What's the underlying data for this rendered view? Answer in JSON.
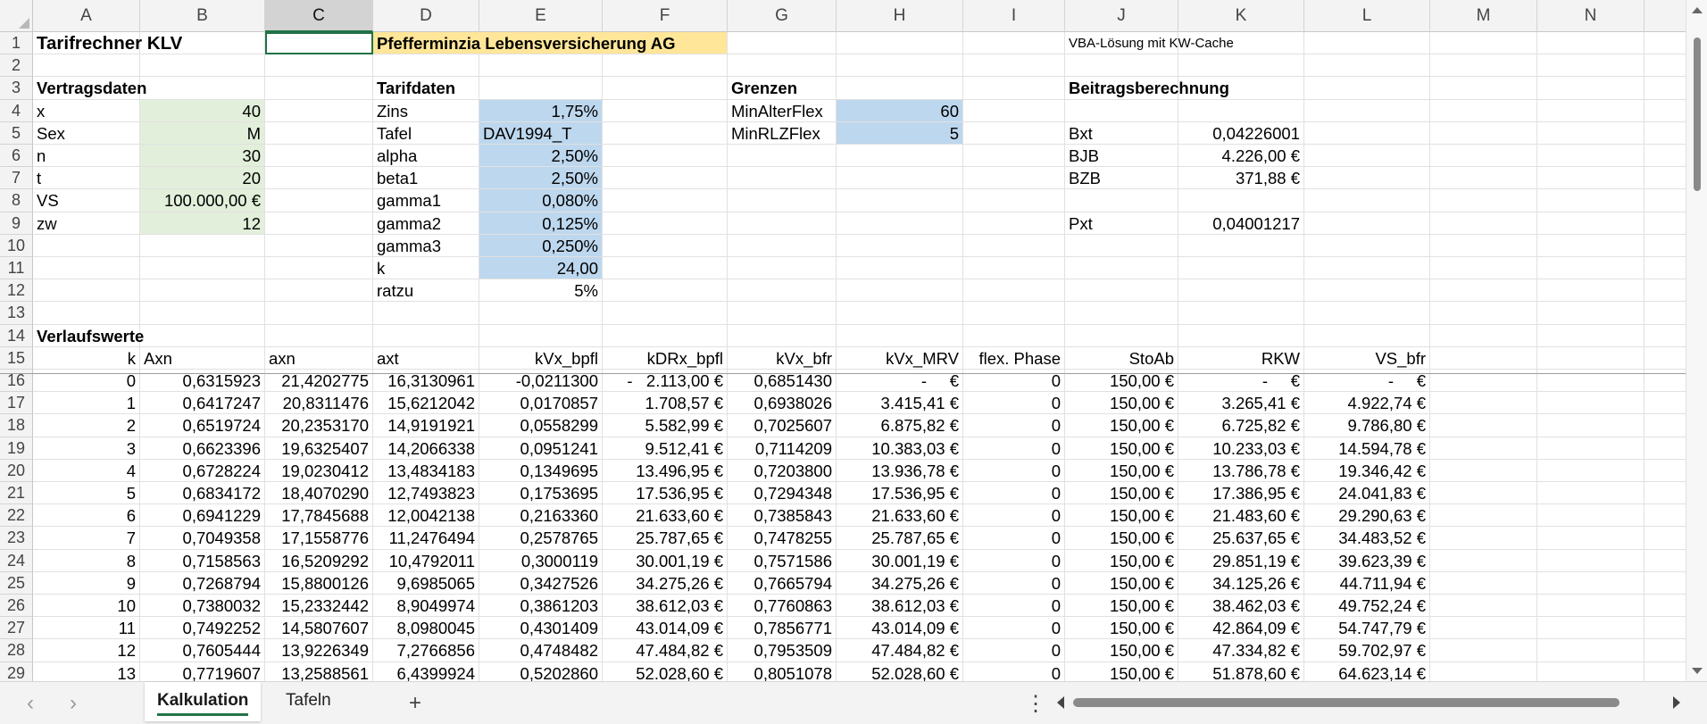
{
  "columns": [
    {
      "id": "A",
      "width": 120
    },
    {
      "id": "B",
      "width": 140
    },
    {
      "id": "C",
      "width": 121
    },
    {
      "id": "D",
      "width": 119
    },
    {
      "id": "E",
      "width": 138
    },
    {
      "id": "F",
      "width": 140
    },
    {
      "id": "G",
      "width": 122
    },
    {
      "id": "H",
      "width": 142
    },
    {
      "id": "I",
      "width": 114
    },
    {
      "id": "J",
      "width": 127
    },
    {
      "id": "K",
      "width": 141
    },
    {
      "id": "L",
      "width": 141
    },
    {
      "id": "M",
      "width": 120
    },
    {
      "id": "N",
      "width": 120
    },
    {
      "id": "O",
      "width": 200
    }
  ],
  "selected_column": "C",
  "rows": [
    {
      "n": 1,
      "cells": [
        {
          "c": "A",
          "v": "Tarifrechner KLV",
          "b": true,
          "big": true
        },
        {
          "c": "C",
          "v": "",
          "sel": true
        },
        {
          "c": "D",
          "v": "Pfefferminzia Lebensversicherung AG",
          "b": true,
          "fill": "yellow",
          "span": 3
        },
        {
          "c": "J",
          "v": "VBA-Lösung mit KW-Cache",
          "small": true,
          "span": 2
        }
      ]
    },
    {
      "n": 2,
      "cells": []
    },
    {
      "n": 3,
      "cells": [
        {
          "c": "A",
          "v": "Vertragsdaten",
          "b": true,
          "span": 2
        },
        {
          "c": "D",
          "v": "Tarifdaten",
          "b": true
        },
        {
          "c": "G",
          "v": "Grenzen",
          "b": true
        },
        {
          "c": "J",
          "v": "Beitragsberechnung",
          "b": true,
          "span": 2
        }
      ]
    },
    {
      "n": 4,
      "cells": [
        {
          "c": "A",
          "v": "x"
        },
        {
          "c": "B",
          "v": "40",
          "r": true,
          "fill": "green"
        },
        {
          "c": "D",
          "v": "Zins"
        },
        {
          "c": "E",
          "v": "1,75%",
          "r": true,
          "fill": "blue"
        },
        {
          "c": "G",
          "v": "MinAlterFlex"
        },
        {
          "c": "H",
          "v": "60",
          "r": true,
          "fill": "blue"
        }
      ]
    },
    {
      "n": 5,
      "cells": [
        {
          "c": "A",
          "v": "Sex"
        },
        {
          "c": "B",
          "v": "M",
          "r": true,
          "fill": "green"
        },
        {
          "c": "D",
          "v": "Tafel"
        },
        {
          "c": "E",
          "v": "DAV1994_T",
          "fill": "blue"
        },
        {
          "c": "G",
          "v": "MinRLZFlex"
        },
        {
          "c": "H",
          "v": "5",
          "r": true,
          "fill": "blue"
        },
        {
          "c": "J",
          "v": "Bxt"
        },
        {
          "c": "K",
          "v": "0,04226001",
          "r": true
        }
      ]
    },
    {
      "n": 6,
      "cells": [
        {
          "c": "A",
          "v": "n"
        },
        {
          "c": "B",
          "v": "30",
          "r": true,
          "fill": "green"
        },
        {
          "c": "D",
          "v": "alpha"
        },
        {
          "c": "E",
          "v": "2,50%",
          "r": true,
          "fill": "blue"
        },
        {
          "c": "J",
          "v": "BJB"
        },
        {
          "c": "K",
          "v": "4.226,00 €",
          "r": true
        }
      ]
    },
    {
      "n": 7,
      "cells": [
        {
          "c": "A",
          "v": "t"
        },
        {
          "c": "B",
          "v": "20",
          "r": true,
          "fill": "green"
        },
        {
          "c": "D",
          "v": "beta1"
        },
        {
          "c": "E",
          "v": "2,50%",
          "r": true,
          "fill": "blue"
        },
        {
          "c": "J",
          "v": "BZB"
        },
        {
          "c": "K",
          "v": "371,88 €",
          "r": true
        }
      ]
    },
    {
      "n": 8,
      "cells": [
        {
          "c": "A",
          "v": "VS"
        },
        {
          "c": "B",
          "v": "100.000,00 €",
          "r": true,
          "fill": "green"
        },
        {
          "c": "D",
          "v": "gamma1"
        },
        {
          "c": "E",
          "v": "0,080%",
          "r": true,
          "fill": "blue"
        }
      ]
    },
    {
      "n": 9,
      "cells": [
        {
          "c": "A",
          "v": "zw"
        },
        {
          "c": "B",
          "v": "12",
          "r": true,
          "fill": "green"
        },
        {
          "c": "D",
          "v": "gamma2"
        },
        {
          "c": "E",
          "v": "0,125%",
          "r": true,
          "fill": "blue"
        },
        {
          "c": "J",
          "v": "Pxt"
        },
        {
          "c": "K",
          "v": "0,04001217",
          "r": true
        }
      ]
    },
    {
      "n": 10,
      "cells": [
        {
          "c": "D",
          "v": "gamma3"
        },
        {
          "c": "E",
          "v": "0,250%",
          "r": true,
          "fill": "blue"
        }
      ]
    },
    {
      "n": 11,
      "cells": [
        {
          "c": "D",
          "v": "k"
        },
        {
          "c": "E",
          "v": "24,00",
          "r": true,
          "fill": "blue"
        }
      ]
    },
    {
      "n": 12,
      "cells": [
        {
          "c": "D",
          "v": "ratzu"
        },
        {
          "c": "E",
          "v": "5%",
          "r": true
        }
      ]
    },
    {
      "n": 13,
      "cells": []
    },
    {
      "n": 14,
      "cells": [
        {
          "c": "A",
          "v": "Verlaufswerte",
          "b": true,
          "span": 2
        }
      ]
    },
    {
      "n": 15,
      "cells": [
        {
          "c": "A",
          "v": "k",
          "r": true
        },
        {
          "c": "B",
          "v": "Axn"
        },
        {
          "c": "C",
          "v": "axn"
        },
        {
          "c": "D",
          "v": "axt"
        },
        {
          "c": "E",
          "v": "kVx_bpfl",
          "r": true
        },
        {
          "c": "F",
          "v": "kDRx_bpfl",
          "r": true
        },
        {
          "c": "G",
          "v": "kVx_bfr",
          "r": true
        },
        {
          "c": "H",
          "v": "kVx_MRV",
          "r": true
        },
        {
          "c": "I",
          "v": "flex. Phase",
          "r": true
        },
        {
          "c": "J",
          "v": "StoAb",
          "r": true
        },
        {
          "c": "K",
          "v": "RKW",
          "r": true
        },
        {
          "c": "L",
          "v": "VS_bfr",
          "r": true
        }
      ]
    }
  ],
  "table_rows": [
    {
      "n": 16,
      "vals": [
        "0",
        "0,6315923",
        "21,4202775",
        "16,3130961",
        "-0,0211300",
        "-   2.113,00 €",
        "0,6851430",
        "-     €",
        "0",
        "150,00 €",
        "-     €",
        "-     €"
      ]
    },
    {
      "n": 17,
      "vals": [
        "1",
        "0,6417247",
        "20,8311476",
        "15,6212042",
        "0,0170857",
        "1.708,57 €",
        "0,6938026",
        "3.415,41 €",
        "0",
        "150,00 €",
        "3.265,41 €",
        "4.922,74 €"
      ]
    },
    {
      "n": 18,
      "vals": [
        "2",
        "0,6519724",
        "20,2353170",
        "14,9191921",
        "0,0558299",
        "5.582,99 €",
        "0,7025607",
        "6.875,82 €",
        "0",
        "150,00 €",
        "6.725,82 €",
        "9.786,80 €"
      ]
    },
    {
      "n": 19,
      "vals": [
        "3",
        "0,6623396",
        "19,6325407",
        "14,2066338",
        "0,0951241",
        "9.512,41 €",
        "0,7114209",
        "10.383,03 €",
        "0",
        "150,00 €",
        "10.233,03 €",
        "14.594,78 €"
      ]
    },
    {
      "n": 20,
      "vals": [
        "4",
        "0,6728224",
        "19,0230412",
        "13,4834183",
        "0,1349695",
        "13.496,95 €",
        "0,7203800",
        "13.936,78 €",
        "0",
        "150,00 €",
        "13.786,78 €",
        "19.346,42 €"
      ]
    },
    {
      "n": 21,
      "vals": [
        "5",
        "0,6834172",
        "18,4070290",
        "12,7493823",
        "0,1753695",
        "17.536,95 €",
        "0,7294348",
        "17.536,95 €",
        "0",
        "150,00 €",
        "17.386,95 €",
        "24.041,83 €"
      ]
    },
    {
      "n": 22,
      "vals": [
        "6",
        "0,6941229",
        "17,7845688",
        "12,0042138",
        "0,2163360",
        "21.633,60 €",
        "0,7385843",
        "21.633,60 €",
        "0",
        "150,00 €",
        "21.483,60 €",
        "29.290,63 €"
      ]
    },
    {
      "n": 23,
      "vals": [
        "7",
        "0,7049358",
        "17,1558776",
        "11,2476494",
        "0,2578765",
        "25.787,65 €",
        "0,7478255",
        "25.787,65 €",
        "0",
        "150,00 €",
        "25.637,65 €",
        "34.483,52 €"
      ]
    },
    {
      "n": 24,
      "vals": [
        "8",
        "0,7158563",
        "16,5209292",
        "10,4792011",
        "0,3000119",
        "30.001,19 €",
        "0,7571586",
        "30.001,19 €",
        "0",
        "150,00 €",
        "29.851,19 €",
        "39.623,39 €"
      ]
    },
    {
      "n": 25,
      "vals": [
        "9",
        "0,7268794",
        "15,8800126",
        "9,6985065",
        "0,3427526",
        "34.275,26 €",
        "0,7665794",
        "34.275,26 €",
        "0",
        "150,00 €",
        "34.125,26 €",
        "44.711,94 €"
      ]
    },
    {
      "n": 26,
      "vals": [
        "10",
        "0,7380032",
        "15,2332442",
        "8,9049974",
        "0,3861203",
        "38.612,03 €",
        "0,7760863",
        "38.612,03 €",
        "0",
        "150,00 €",
        "38.462,03 €",
        "49.752,24 €"
      ]
    },
    {
      "n": 27,
      "vals": [
        "11",
        "0,7492252",
        "14,5807607",
        "8,0980045",
        "0,4301409",
        "43.014,09 €",
        "0,7856771",
        "43.014,09 €",
        "0",
        "150,00 €",
        "42.864,09 €",
        "54.747,79 €"
      ]
    },
    {
      "n": 28,
      "vals": [
        "12",
        "0,7605444",
        "13,9226349",
        "7,2766856",
        "0,4748482",
        "47.484,82 €",
        "0,7953509",
        "47.484,82 €",
        "0",
        "150,00 €",
        "47.334,82 €",
        "59.702,97 €"
      ]
    },
    {
      "n": 29,
      "vals": [
        "13",
        "0,7719607",
        "13,2588561",
        "6,4399924",
        "0,5202860",
        "52.028,60 €",
        "0,8051078",
        "52.028,60 €",
        "0",
        "150,00 €",
        "51.878,60 €",
        "64.623,14 €"
      ]
    }
  ],
  "tabs": {
    "prev_label": "‹",
    "next_label": "›",
    "sheet1": "Kalkulation",
    "sheet2": "Tafeln",
    "add_label": "+",
    "more_label": "⋮"
  },
  "icons": {
    "prev": "chevron-left-icon",
    "next": "chevron-right-icon",
    "add": "plus-icon"
  },
  "colors": {
    "accent": "#217346",
    "input_green": "#e2efda",
    "param_blue": "#bdd7ee",
    "title_yellow": "#ffe699"
  }
}
